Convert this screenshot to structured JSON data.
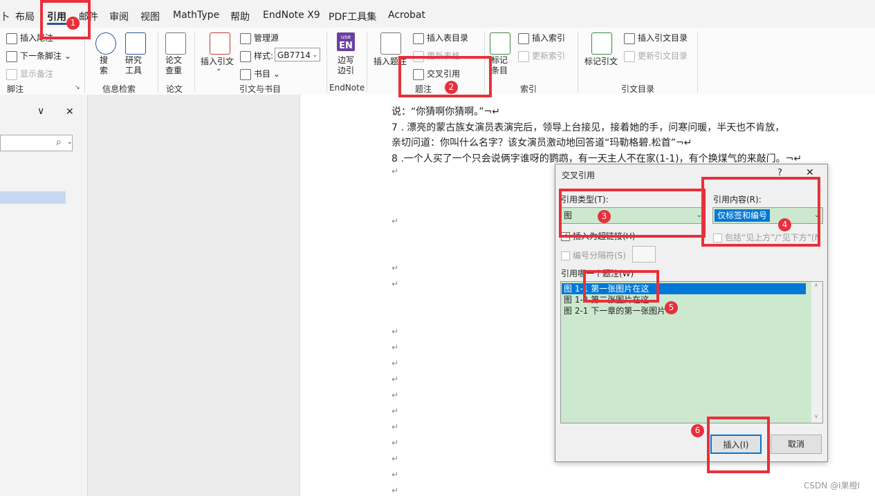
{
  "tabs": [
    "卜",
    "布局",
    "引用",
    "邮件",
    "审阅",
    "视图",
    "MathType",
    "帮助",
    "EndNote X9",
    "PDF工具集",
    "Acrobat"
  ],
  "ribbon": {
    "footnote": {
      "insert_endnote": "插入尾注",
      "next_footnote": "下一条脚注",
      "show_notes": "显示备注",
      "label": "脚注"
    },
    "search": {
      "search": "搜\n索",
      "research": "研究\n工具",
      "label": "信息检索"
    },
    "paper": {
      "check": "论文\n查重",
      "label": "论文"
    },
    "citations": {
      "insert_citation": "插入引文",
      "manage_sources": "管理源",
      "style_label": "样式:",
      "style_value": "GB7714",
      "bibliography": "书目",
      "label": "引文与书目"
    },
    "endnote": {
      "icon_top": "use",
      "icon_main": "EN",
      "write_cite": "边写\n边引",
      "label": "EndNote"
    },
    "captions": {
      "insert_caption": "插入题注",
      "insert_tof": "插入表目录",
      "update_table": "更新表格",
      "cross_ref": "交叉引用",
      "label": "题注"
    },
    "index": {
      "mark_entry": "标记\n条目",
      "insert_index": "插入索引",
      "update_index": "更新索引",
      "label": "索引"
    },
    "toa": {
      "mark_citation": "标记引文",
      "insert_toa": "插入引文目录",
      "update_toa": "更新引文目录",
      "label": "引文目录"
    }
  },
  "leftpane": {
    "chevron": "∨",
    "close": "✕",
    "search_icon": "⌕"
  },
  "document": {
    "lines": [
      "说：“你猜啊你猜啊。”¬↵",
      "7 . 漂亮的蒙古族女演员表演完后，领导上台接见，接着她的手，问寒问暖，半天也不肯放，",
      "亲切问道：你叫什么名字？该女演员激动地回答道“玛勒格碧.松首”¬↵",
      "8 .一个人买了一个只会说俩字谁呀的鹦鹉，有一天主人不在家(1-1)，有个换煤气的来敲门。¬↵"
    ],
    "para_mark": "↵"
  },
  "dialog": {
    "title": "交叉引用",
    "help": "?",
    "close": "✕",
    "ref_type_label": "引用类型(T):",
    "ref_type_value": "图",
    "ref_content_label": "引用内容(R):",
    "ref_content_value": "仅标签和编号",
    "insert_hyperlink": "插入为超链接(H)",
    "include_above_below": "包括“见上方”/“见下方”(N",
    "separator_label": "编号分隔符(S)",
    "which_caption_label": "引用哪一个题注(W)",
    "captions": [
      "图 1-1 第一张图片在这",
      "图 1-2 第二张图片在这",
      "图 2-1 下一章的第一张图片"
    ],
    "insert_button": "插入(I)",
    "cancel_button": "取消"
  },
  "annotations": [
    "1",
    "2",
    "3",
    "4",
    "5",
    "6"
  ],
  "watermark": "CSDN @I果橙I",
  "colors": {
    "accent": "#2b579a",
    "annotation": "#e8303a",
    "selection": "#0078d7",
    "list_bg": "#cce8cf"
  }
}
